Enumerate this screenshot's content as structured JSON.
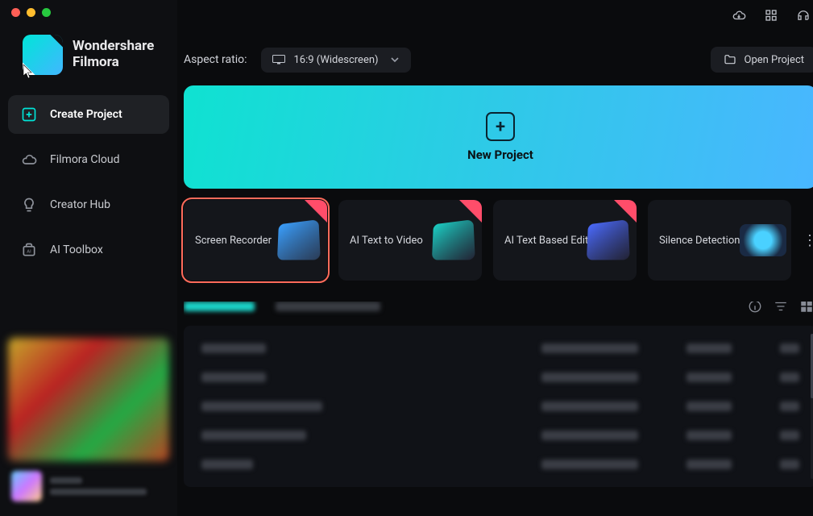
{
  "brand": {
    "line1": "Wondershare",
    "line2": "Filmora"
  },
  "sidebar": {
    "items": [
      {
        "label": "Create Project",
        "icon": "plus-square-icon"
      },
      {
        "label": "Filmora Cloud",
        "icon": "cloud-icon"
      },
      {
        "label": "Creator Hub",
        "icon": "bulb-icon"
      },
      {
        "label": "AI Toolbox",
        "icon": "ai-box-icon"
      }
    ]
  },
  "toolbar": {
    "aspect_label": "Aspect ratio:",
    "aspect_value": "16:9 (Widescreen)",
    "open_project_label": "Open Project"
  },
  "new_project": {
    "label": "New Project"
  },
  "tools": {
    "cards": [
      {
        "label": "Screen Recorder",
        "new": true,
        "selected": true
      },
      {
        "label": "AI Text to Video",
        "new": true,
        "selected": false
      },
      {
        "label": "AI Text Based Edit",
        "new": true,
        "selected": false
      },
      {
        "label": "Silence Detection",
        "new": false,
        "selected": false
      }
    ]
  },
  "projects": {
    "tabs_blurred": true,
    "rows_blurred": 5
  },
  "top_icons": [
    "cloud-download-icon",
    "grid-apps-icon",
    "headset-icon"
  ]
}
